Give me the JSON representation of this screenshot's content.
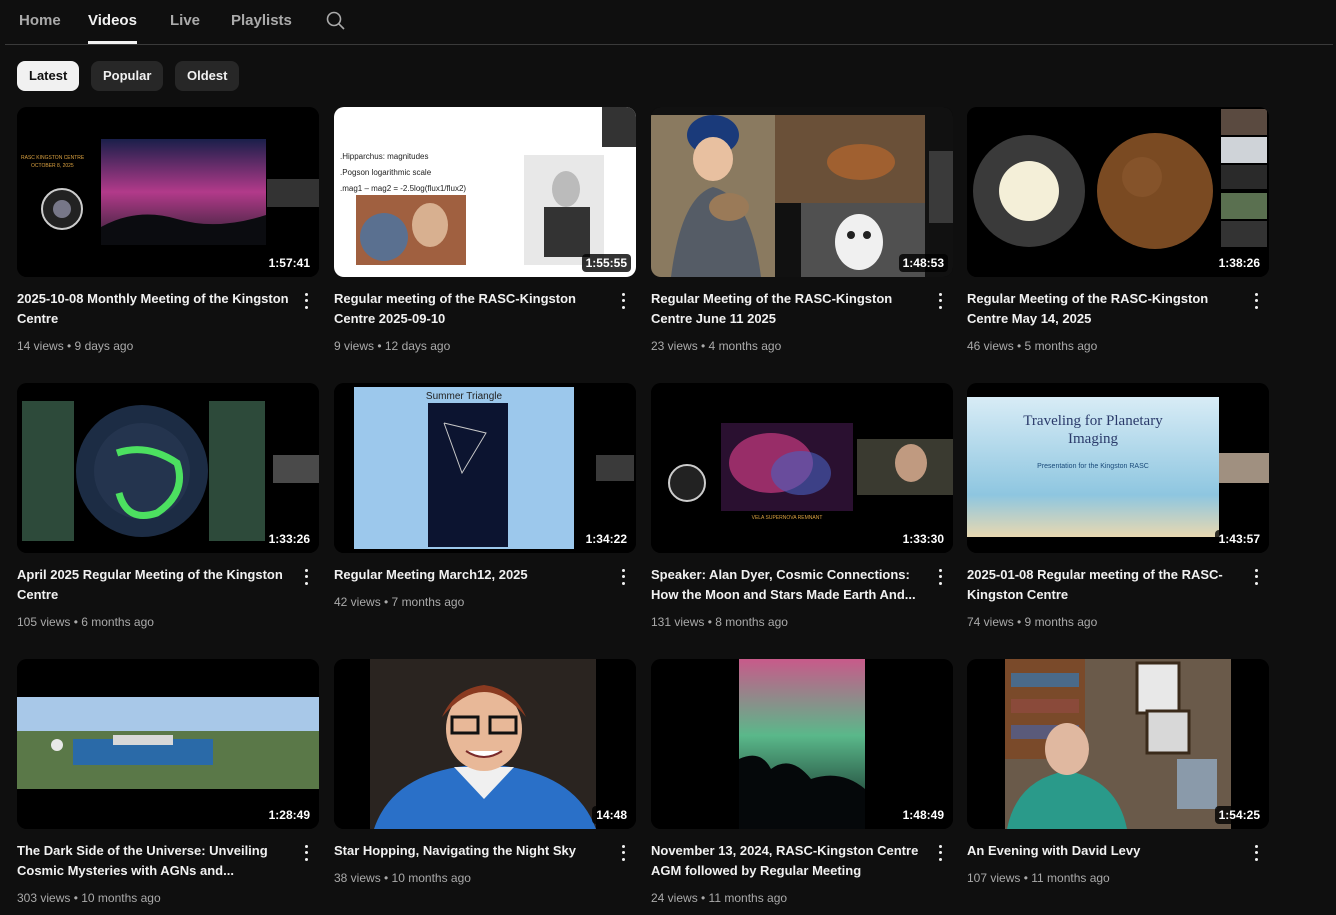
{
  "tabs": [
    {
      "label": "Home"
    },
    {
      "label": "Videos"
    },
    {
      "label": "Live"
    },
    {
      "label": "Playlists"
    }
  ],
  "chips": [
    {
      "label": "Latest"
    },
    {
      "label": "Popular"
    },
    {
      "label": "Oldest"
    }
  ],
  "videos": [
    {
      "title": "2025-10-08 Monthly Meeting of the Kingston Centre",
      "meta": "14 views • 9 days ago",
      "duration": "1:57:41",
      "overlay": "RASC KINGSTON CENTRE\nOCTOBER 8, 2025"
    },
    {
      "title": "Regular meeting of the RASC-Kingston Centre 2025-09-10",
      "meta": "9 views • 12 days ago",
      "duration": "1:55:55",
      "overlay": ".Hipparchus: magnitudes\n.Pogson logarithmic scale\n.mag1 – mag2 = -2.5log(flux1/flux2)"
    },
    {
      "title": "Regular Meeting of the RASC-Kingston Centre June 11 2025",
      "meta": "23 views • 4 months ago",
      "duration": "1:48:53",
      "overlay": ""
    },
    {
      "title": "Regular Meeting of the RASC-Kingston Centre May 14, 2025",
      "meta": "46 views • 5 months ago",
      "duration": "1:38:26",
      "overlay": ""
    },
    {
      "title": "April 2025 Regular Meeting of the Kingston Centre",
      "meta": "105 views • 6 months ago",
      "duration": "1:33:26",
      "overlay": ""
    },
    {
      "title": "Regular Meeting March12, 2025",
      "meta": "42 views • 7 months ago",
      "duration": "1:34:22",
      "overlay": "Summer Triangle"
    },
    {
      "title": "Speaker: Alan Dyer, Cosmic Connections: How the Moon and Stars Made Earth And...",
      "meta": "131 views • 8 months ago",
      "duration": "1:33:30",
      "overlay": "VELA SUPERNOVA REMNANT"
    },
    {
      "title": "2025-01-08 Regular meeting of the RASC-Kingston Centre",
      "meta": "74 views • 9 months ago",
      "duration": "1:43:57",
      "overlay": "Traveling for Planetary\nImaging\nPresentation for the Kingston RASC"
    },
    {
      "title": "The Dark Side of the Universe: Unveiling Cosmic Mysteries with AGNs and...",
      "meta": "303 views • 10 months ago",
      "duration": "1:28:49",
      "overlay": ""
    },
    {
      "title": "Star Hopping, Navigating the Night Sky",
      "meta": "38 views • 10 months ago",
      "duration": "14:48",
      "overlay": ""
    },
    {
      "title": "November 13, 2024, RASC-Kingston Centre AGM followed by Regular Meeting",
      "meta": "24 views • 11 months ago",
      "duration": "1:48:49",
      "overlay": ""
    },
    {
      "title": "An Evening with David Levy",
      "meta": "107 views • 11 months ago",
      "duration": "1:54:25",
      "overlay": ""
    }
  ],
  "icons": {
    "search": "search-icon",
    "more": "more-vert-icon"
  },
  "colors": {
    "background": "#0f0f0f",
    "chip": "#272727",
    "chip_active": "#f1f1f1",
    "meta_text": "#aaaaaa"
  }
}
